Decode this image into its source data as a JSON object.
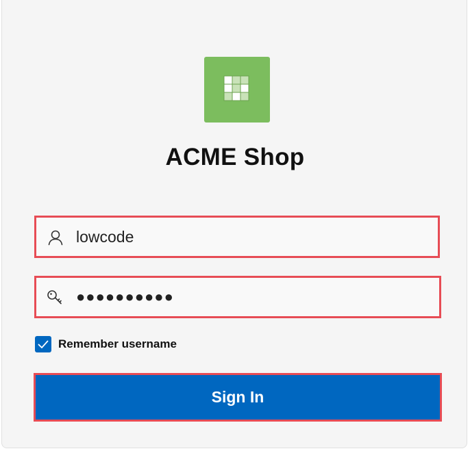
{
  "app": {
    "title": "ACME Shop",
    "logo_icon": "grid-table-icon",
    "logo_color": "#7cbd5e"
  },
  "login": {
    "username": {
      "icon": "user-icon",
      "value": "lowcode"
    },
    "password": {
      "icon": "key-icon",
      "value": "●●●●●●●●●●"
    },
    "remember": {
      "label": "Remember username",
      "checked": true
    },
    "signin_label": "Sign In"
  },
  "colors": {
    "accent": "#0067c0",
    "highlight_border": "#e74c55",
    "background": "#f5f5f5"
  }
}
